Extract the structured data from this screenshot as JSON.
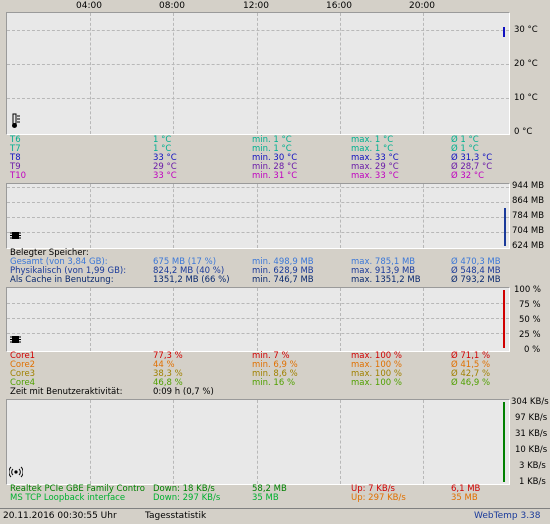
{
  "time_axis": {
    "labels": [
      "04:00",
      "08:00",
      "12:00",
      "16:00",
      "20:00"
    ]
  },
  "temperature": {
    "axis": [
      "30 °C",
      "20 °C",
      "10 °C",
      "0 °C"
    ],
    "sensors": [
      {
        "name": "T6",
        "current": "1 °C",
        "min": "min. 1 °C",
        "max": "max. 1 °C",
        "avg": "Ø 1 °C",
        "color": "#00b090"
      },
      {
        "name": "T7",
        "current": "1 °C",
        "min": "min. 1 °C",
        "max": "max. 1 °C",
        "avg": "Ø 1 °C",
        "color": "#00b090"
      },
      {
        "name": "T8",
        "current": "33 °C",
        "min": "min. 30 °C",
        "max": "max. 33 °C",
        "avg": "Ø 31,3 °C",
        "color": "#1010c0"
      },
      {
        "name": "T9",
        "current": "29 °C",
        "min": "min. 28 °C",
        "max": "max. 29 °C",
        "avg": "Ø 28,7 °C",
        "color": "#6a1aa8"
      },
      {
        "name": "T10",
        "current": "33 °C",
        "min": "min. 31 °C",
        "max": "max. 33 °C",
        "avg": "Ø 32 °C",
        "color": "#c000c0"
      }
    ]
  },
  "memory": {
    "axis": [
      "944 MB",
      "864 MB",
      "784 MB",
      "704 MB",
      "624 MB"
    ],
    "header": "Belegter Speicher:",
    "rows": [
      {
        "name": "Gesamt (von 3,84 GB):",
        "current": "675 MB (17 %)",
        "min": "min. 498,9 MB",
        "max": "max. 785,1 MB",
        "avg": "Ø 470,3 MB",
        "color": "#3c78d8"
      },
      {
        "name": "Physikalisch (von 1,99 GB):",
        "current": "824,2 MB (40 %)",
        "min": "min. 628,9 MB",
        "max": "max. 913,9 MB",
        "avg": "Ø 548,4 MB",
        "color": "#1a3a9a"
      },
      {
        "name": "Als Cache in Benutzung:",
        "current": "1351,2 MB (66 %)",
        "min": "min. 746,7 MB",
        "max": "max. 1351,2 MB",
        "avg": "Ø 793,2 MB",
        "color": "#0a2a70"
      }
    ]
  },
  "cpu": {
    "axis": [
      "100 %",
      "75 %",
      "50 %",
      "25 %",
      "0 %"
    ],
    "cores": [
      {
        "name": "Core1",
        "current": "77,3 %",
        "min": "min. 7 %",
        "max": "max. 100 %",
        "avg": "Ø 71,1 %",
        "color": "#d00000"
      },
      {
        "name": "Core2",
        "current": "44 %",
        "min": "min. 6,9 %",
        "max": "max. 100 %",
        "avg": "Ø 41,5 %",
        "color": "#e07000"
      },
      {
        "name": "Core3",
        "current": "38,3 %",
        "min": "min. 8,6 %",
        "max": "max. 100 %",
        "avg": "Ø 42,7 %",
        "color": "#a08000"
      },
      {
        "name": "Core4",
        "current": "46,8 %",
        "min": "min. 16 %",
        "max": "max. 100 %",
        "avg": "Ø 46,9 %",
        "color": "#50a000"
      }
    ],
    "activity_label": "Zeit mit Benutzeraktivität:",
    "activity_value": "0:09 h (0,7 %)"
  },
  "network": {
    "axis": [
      "304 KB/s",
      "97 KB/s",
      "31 KB/s",
      "10 KB/s",
      "3 KB/s",
      "1 KB/s"
    ],
    "interfaces": [
      {
        "name": "Realtek PCIe GBE Family Contro",
        "down": "Down: 18 KB/s",
        "down_total": "58,2 MB",
        "up": "Up: 7 KB/s",
        "up_total": "6,1 MB",
        "color": "#008000",
        "up_color": "#d00000"
      },
      {
        "name": "MS TCP Loopback interface",
        "down": "Down: 297 KB/s",
        "down_total": "35 MB",
        "up": "Up: 297 KB/s",
        "up_total": "35 MB",
        "color": "#00b030",
        "up_color": "#e07000"
      }
    ]
  },
  "status_bar": {
    "datetime": "20.11.2016 00:30:55 Uhr",
    "stats_label": "Tagesstatistik",
    "app": "WebTemp 3.38"
  }
}
